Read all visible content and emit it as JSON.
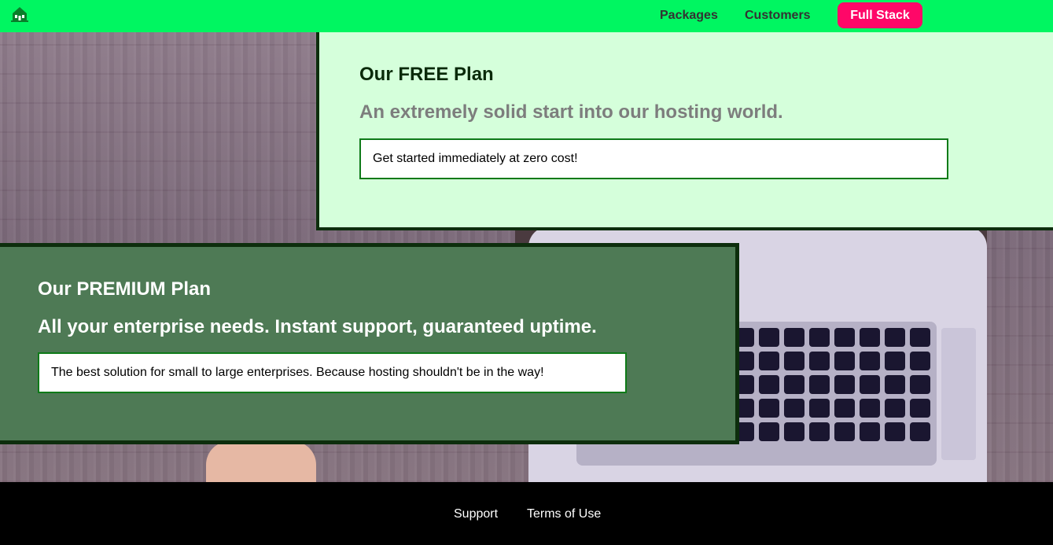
{
  "header": {
    "logo_icon": "building-logo-icon",
    "brand_color": "#00f661",
    "nav": {
      "packages_label": "Packages",
      "customers_label": "Customers",
      "cta_label": "Full Stack",
      "cta_color": "#ff0768"
    }
  },
  "plans": {
    "free": {
      "title": "Our FREE Plan",
      "subtitle": "An extremely solid start into our hosting world.",
      "description": "Get started immediately at zero cost!",
      "background": "#d5ffdb"
    },
    "premium": {
      "title": "Our PREMIUM Plan",
      "subtitle": "All your enterprise needs. Instant support, guaranteed uptime.",
      "description": "The best solution for small to large enterprises. Because hosting shouldn't be in the way!",
      "background": "#4e7a55"
    }
  },
  "footer": {
    "support_label": "Support",
    "terms_label": "Terms of Use"
  }
}
